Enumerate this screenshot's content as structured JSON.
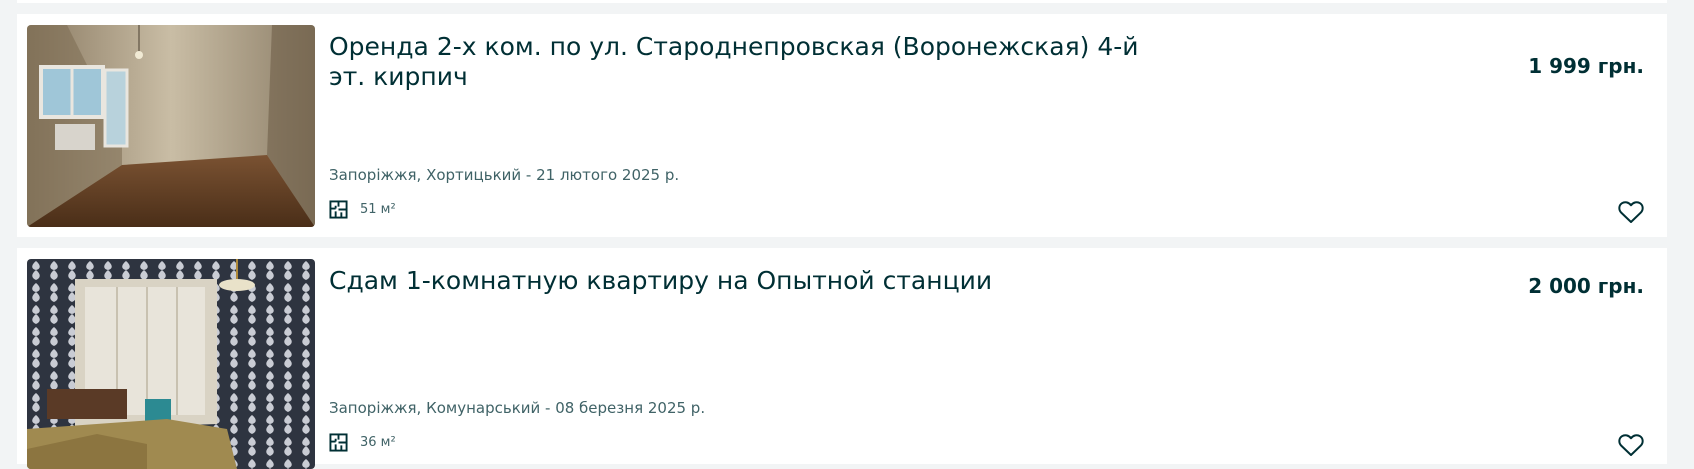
{
  "listings": [
    {
      "title": "Оренда 2-х ком. по ул. Староднепровская (Воронежская) 4-й эт. кирпич",
      "price": "1 999 грн.",
      "meta": "Запоріжжя, Хортицький - 21 лютого 2025 р.",
      "area": "51 м²",
      "photo": "empty-room-photo",
      "icons": {
        "area": "floor-plan-icon",
        "favorite": "heart-outline-icon"
      }
    },
    {
      "title": "Сдам 1-комнатную квартиру на Опытной станции",
      "price": "2 000 грн.",
      "meta": "Запоріжжя, Комунарський - 08 березня 2025 р.",
      "area": "36 м²",
      "photo": "patterned-wallpaper-room-photo",
      "icons": {
        "area": "floor-plan-icon",
        "favorite": "heart-outline-icon"
      }
    }
  ],
  "colors": {
    "page_background": "#f2f4f5",
    "card_background": "#ffffff",
    "text_primary": "#002f34",
    "text_secondary": "#406367"
  }
}
